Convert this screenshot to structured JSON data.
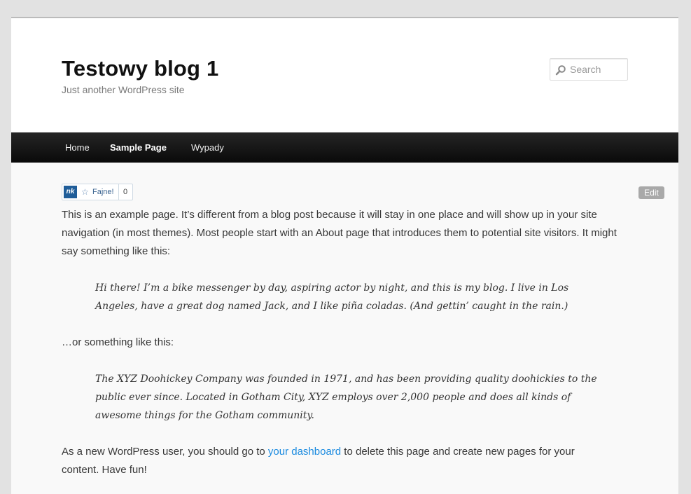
{
  "header": {
    "site_title": "Testowy blog 1",
    "site_description": "Just another WordPress site"
  },
  "search": {
    "placeholder": "Search",
    "icon": "search-icon"
  },
  "nav": {
    "items": [
      {
        "label": "Home"
      },
      {
        "label": "Sample Page",
        "current": true
      },
      {
        "label": "Wypady"
      }
    ]
  },
  "like_widget": {
    "logo": "nk",
    "label": "Fajne!",
    "count": "0"
  },
  "edit_button": {
    "label": "Edit"
  },
  "content": {
    "paragraph_1": "This is an example page. It’s different from a blog post because it will stay in one place and will show up in your site navigation (in most themes). Most people start with an About page that introduces them to potential site visitors. It might say something like this:",
    "quote_1": "Hi there! I’m a bike messenger by day, aspiring actor by night, and this is my blog. I live in Los Angeles, have a great dog named Jack, and I like piña coladas. (And gettin’ caught in the rain.)",
    "paragraph_2": "…or something like this:",
    "quote_2": "The XYZ Doohickey Company was founded in 1971, and has been providing quality doohickies to the public ever since. Located in Gotham City, XYZ employs over 2,000 people and does all kinds of awesome things for the Gotham community.",
    "paragraph_3_before": "As a new WordPress user, you should go to ",
    "paragraph_3_link": "your dashboard",
    "paragraph_3_after": " to delete this page and create new pages for your content. Have fun!"
  },
  "colors": {
    "link": "#1b8be0",
    "nav_background": "#111111",
    "content_background": "#f9f9f9"
  }
}
